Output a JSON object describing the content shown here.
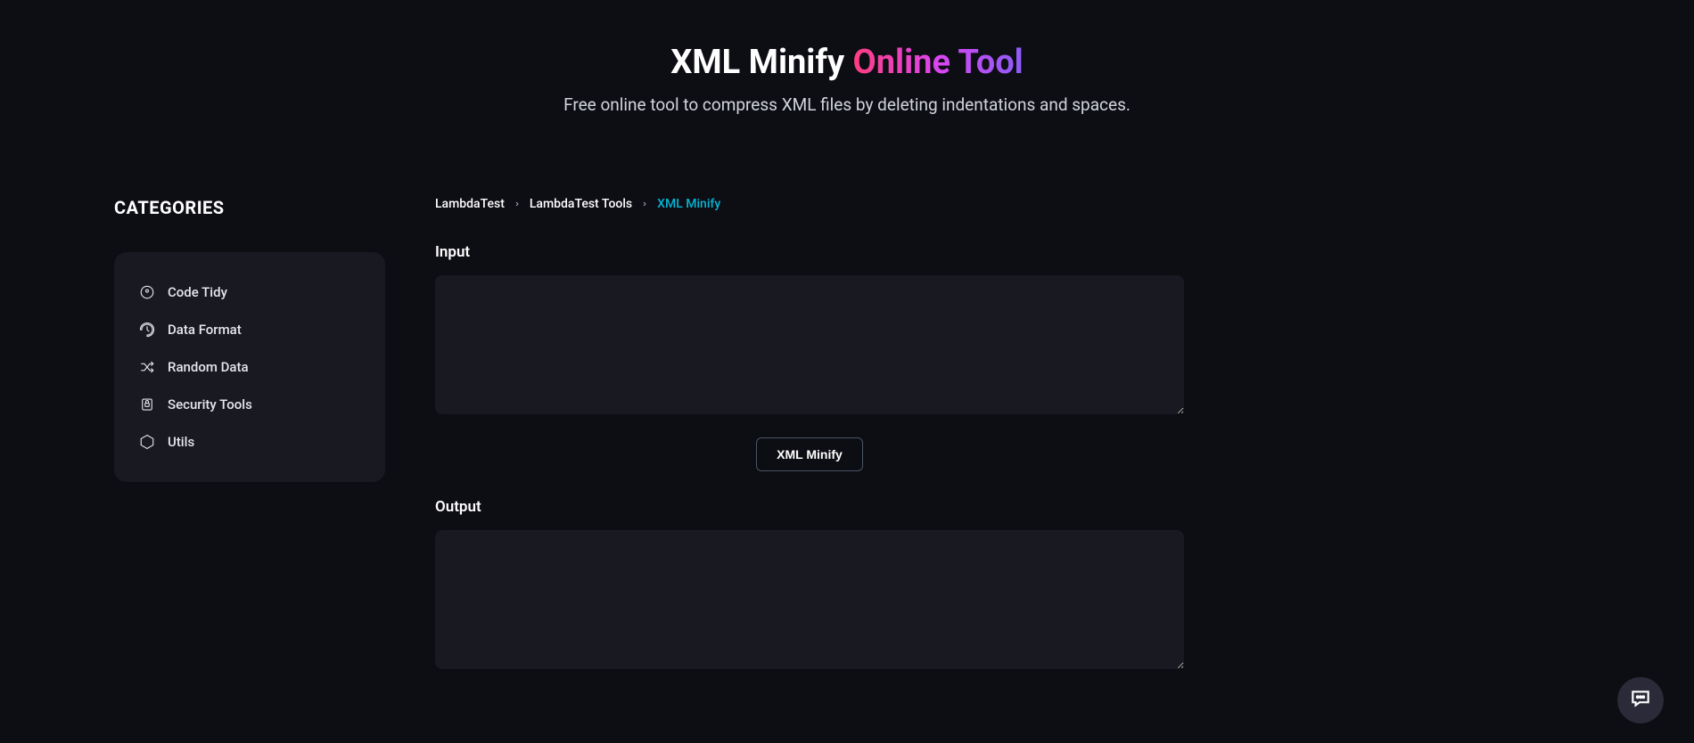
{
  "hero": {
    "title_main": "XML Minify ",
    "title_accent": "Online Tool",
    "subtitle": "Free online tool to compress XML files by deleting indentations and spaces."
  },
  "sidebar": {
    "heading": "CATEGORIES",
    "items": [
      {
        "label": "Code Tidy"
      },
      {
        "label": "Data Format"
      },
      {
        "label": "Random Data"
      },
      {
        "label": "Security Tools"
      },
      {
        "label": "Utils"
      }
    ]
  },
  "breadcrumb": {
    "items": [
      {
        "label": "LambdaTest"
      },
      {
        "label": "LambdaTest Tools"
      }
    ],
    "current": "XML Minify"
  },
  "main": {
    "input_label": "Input",
    "input_value": "",
    "action_label": "XML Minify",
    "output_label": "Output",
    "output_value": ""
  }
}
